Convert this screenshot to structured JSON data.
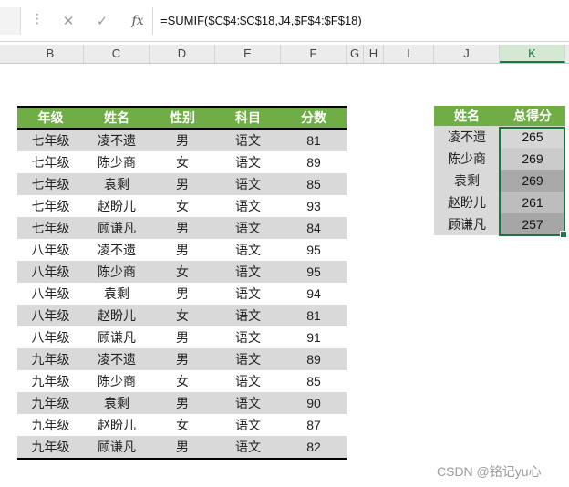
{
  "formula_bar": {
    "dots": "⋮",
    "cancel_icon": "✕",
    "enter_icon": "✓",
    "fx_label": "fx",
    "formula": "=SUMIF($C$4:$C$18,J4,$F$4:$F$18)"
  },
  "columns": [
    {
      "label": "B"
    },
    {
      "label": "C"
    },
    {
      "label": "D"
    },
    {
      "label": "E"
    },
    {
      "label": "F"
    },
    {
      "label": "G"
    },
    {
      "label": "H"
    },
    {
      "label": "I"
    },
    {
      "label": "J"
    },
    {
      "label": "K",
      "active": true
    }
  ],
  "main_table": {
    "headers": [
      "年级",
      "姓名",
      "性别",
      "科目",
      "分数"
    ],
    "rows": [
      [
        "七年级",
        "凌不遗",
        "男",
        "语文",
        "81"
      ],
      [
        "七年级",
        "陈少商",
        "女",
        "语文",
        "89"
      ],
      [
        "七年级",
        "袁剩",
        "男",
        "语文",
        "85"
      ],
      [
        "七年级",
        "赵盼儿",
        "女",
        "语文",
        "93"
      ],
      [
        "七年级",
        "顾谦凡",
        "男",
        "语文",
        "84"
      ],
      [
        "八年级",
        "凌不遗",
        "男",
        "语文",
        "95"
      ],
      [
        "八年级",
        "陈少商",
        "女",
        "语文",
        "95"
      ],
      [
        "八年级",
        "袁剩",
        "男",
        "语文",
        "94"
      ],
      [
        "八年级",
        "赵盼儿",
        "女",
        "语文",
        "81"
      ],
      [
        "八年级",
        "顾谦凡",
        "男",
        "语文",
        "91"
      ],
      [
        "九年级",
        "凌不遗",
        "男",
        "语文",
        "89"
      ],
      [
        "九年级",
        "陈少商",
        "女",
        "语文",
        "85"
      ],
      [
        "九年级",
        "袁剩",
        "男",
        "语文",
        "90"
      ],
      [
        "九年级",
        "赵盼儿",
        "女",
        "语文",
        "87"
      ],
      [
        "九年级",
        "顾谦凡",
        "男",
        "语文",
        "82"
      ]
    ]
  },
  "summary_table": {
    "headers": [
      "姓名",
      "总得分"
    ],
    "rows": [
      {
        "name": "凌不遗",
        "total": "265"
      },
      {
        "name": "陈少商",
        "total": "269"
      },
      {
        "name": "袁剩",
        "total": "269"
      },
      {
        "name": "赵盼儿",
        "total": "261"
      },
      {
        "name": "顾谦凡",
        "total": "257"
      }
    ]
  },
  "watermark": "CSDN @铭记yu心",
  "colors": {
    "header_green": "#70ad47",
    "row_shade": "#d9d9d9",
    "selection": "#217346",
    "selected_cell_fills": [
      "#d6d6d6",
      "#cbcbcb",
      "#a8a8a8",
      "#bdbdbd",
      "#a6a6a6"
    ]
  }
}
